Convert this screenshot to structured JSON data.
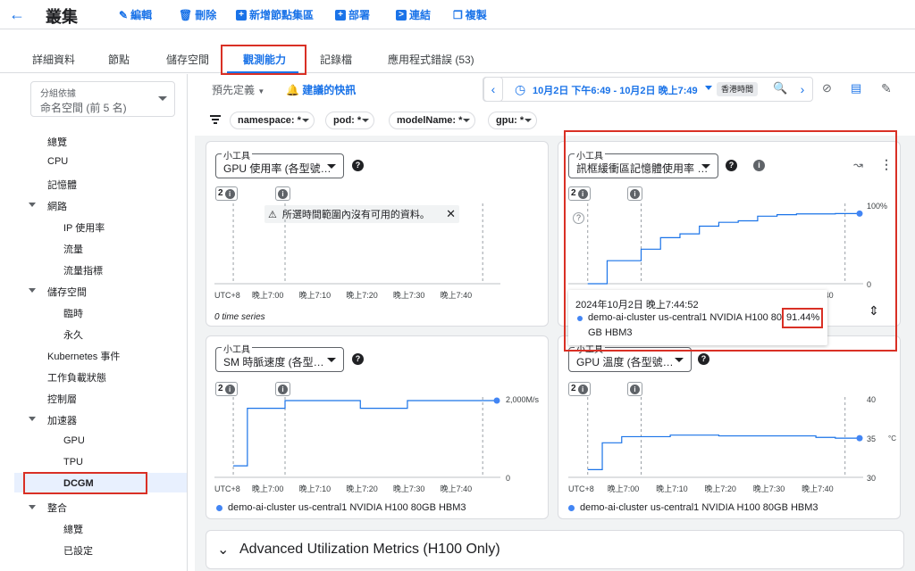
{
  "header": {
    "title": "叢集",
    "buttons": [
      "編輯",
      "刪除",
      "新增節點集區",
      "部署",
      "連結",
      "複製"
    ]
  },
  "tabs": [
    "詳細資料",
    "節點",
    "儲存空間",
    "觀測能力",
    "記錄檔",
    "應用程式錯誤 (53)"
  ],
  "sidebar": {
    "group_by_label": "分組依據",
    "group_by_value": "命名空間 (前 5 名)",
    "items": [
      "總覽",
      "CPU",
      "記憶體",
      "網路",
      "IP 使用率",
      "流量",
      "流量指標",
      "儲存空間",
      "臨時",
      "永久",
      "Kubernetes 事件",
      "工作負載狀態",
      "控制層",
      "加速器",
      "GPU",
      "TPU",
      "DCGM",
      "整合",
      "總覽",
      "已設定"
    ]
  },
  "toolbar": {
    "preset": "預先定義",
    "suggested": "建議的快訊",
    "time_range": "10月2日 下午6:49 - 10月2日 晚上7:49",
    "timezone": "香港時間"
  },
  "filters": [
    "namespace: *",
    "pod: *",
    "modelName: *",
    "gpu: *"
  ],
  "widgets": {
    "label": "小工具",
    "w1_title": "GPU 使用率 (各型號…",
    "w1_nodata": "所選時間範圍內沒有可用的資料。",
    "w1_footer": "0 time series",
    "w2_title": "訊框緩衝區記憶體使用率 …",
    "w3_title": "SM 時脈速度 (各型…",
    "w4_title": "GPU 溫度 (各型號…",
    "event_count": "2",
    "x_ticks": [
      "UTC+8",
      "晚上7:00",
      "晚上7:10",
      "晚上7:20",
      "晚上7:30",
      "晚上7:40"
    ],
    "w2_y_top": "100%",
    "w2_y_bottom": "0",
    "w3_y_top": "2,000M/s",
    "w3_y_bottom": "0",
    "w4_y_top": "40",
    "w4_y_mid": "35",
    "w4_y_bottom": "30",
    "w4_unit": "°C",
    "series_name": "demo-ai-cluster us-central1 NVIDIA H100 80GB HBM3",
    "tooltip_time": "2024年10月2日 晚上7:44:52",
    "tooltip_series_a": "demo-ai-cluster us-central1 NVIDIA H100 80",
    "tooltip_series_b": "GB HBM3",
    "tooltip_value": "91.44%"
  },
  "advanced": "Advanced Utilization Metrics (H100 Only)",
  "chart_data": [
    {
      "type": "line",
      "title": "GPU 使用率 (各型號…",
      "x": [
        "晚上7:00",
        "晚上7:10",
        "晚上7:20",
        "晚上7:30",
        "晚上7:40"
      ],
      "series": []
    },
    {
      "type": "line",
      "title": "訊框緩衝區記憶體使用率 …",
      "ylim": [
        0,
        100
      ],
      "x": [
        "晚上6:53",
        "晚上6:57",
        "晚上7:01",
        "晚上7:04",
        "晚上7:08",
        "晚上7:12",
        "晚上7:16",
        "晚上7:20",
        "晚上7:24",
        "晚上7:28",
        "晚上7:32",
        "晚上7:36",
        "晚上7:40",
        "晚上7:44"
      ],
      "series": [
        {
          "name": "demo-ai-cluster us-central1 NVIDIA H100 80GB HBM3",
          "values": [
            0,
            30,
            30,
            45,
            60,
            65,
            75,
            80,
            82,
            88,
            90,
            91,
            91,
            91.44
          ]
        }
      ]
    },
    {
      "type": "line",
      "title": "SM 時脈速度 (各型…",
      "ylim": [
        0,
        2000
      ],
      "x": [
        "晚上6:53",
        "晚上6:56",
        "晚上7:04",
        "晚上7:19",
        "晚上7:20",
        "晚上7:30",
        "晚上7:44"
      ],
      "series": [
        {
          "name": "demo-ai-cluster us-central1 NVIDIA H100 80GB HBM3",
          "values": [
            300,
            1800,
            2000,
            2000,
            1800,
            2000,
            2000
          ]
        }
      ]
    },
    {
      "type": "line",
      "title": "GPU 溫度 (各型號…",
      "ylim": [
        30,
        40
      ],
      "x": [
        "晚上6:53",
        "晚上6:56",
        "晚上7:00",
        "晚上7:10",
        "晚上7:20",
        "晚上7:30",
        "晚上7:40",
        "晚上7:44"
      ],
      "series": [
        {
          "name": "demo-ai-cluster us-central1 NVIDIA H100 80GB HBM3",
          "values": [
            31,
            34.5,
            35.3,
            35.5,
            35.4,
            35.4,
            35.2,
            35.1
          ]
        }
      ]
    }
  ]
}
